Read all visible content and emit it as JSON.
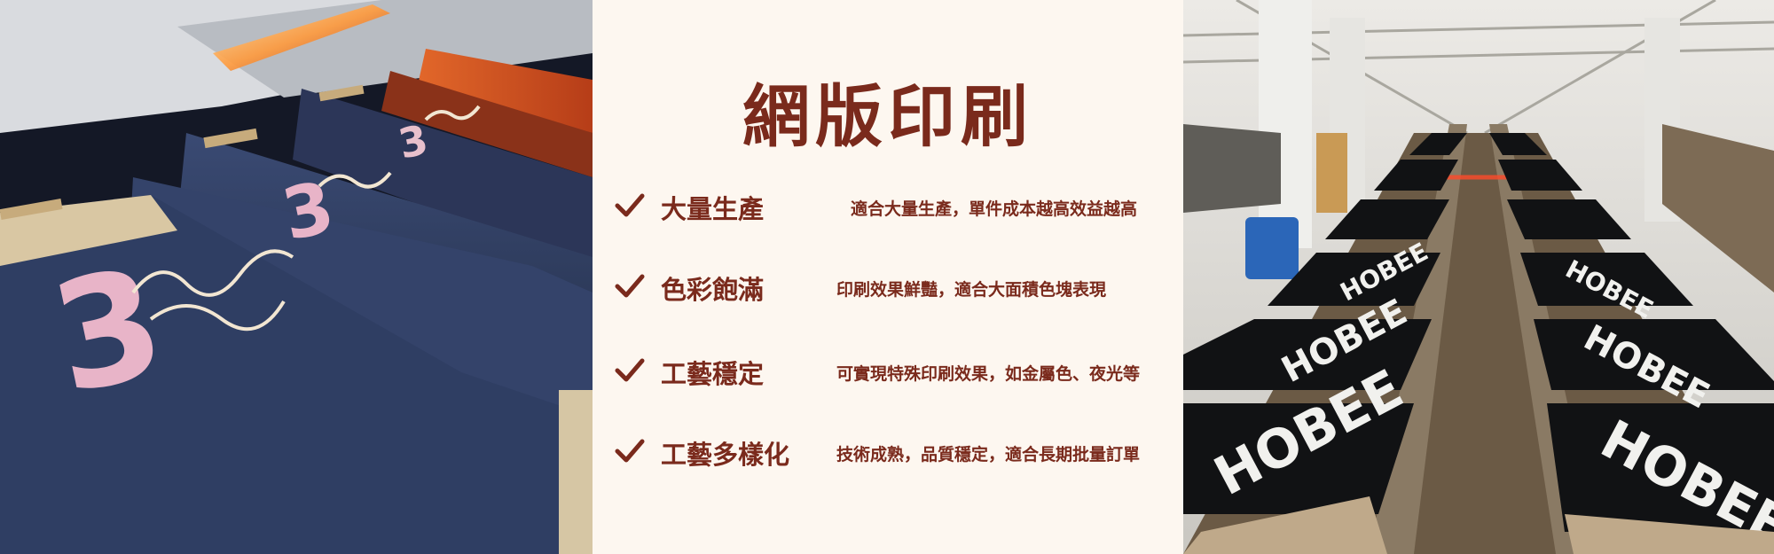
{
  "title": "網版印刷",
  "features": [
    {
      "title": "大量生產",
      "desc": "適合大量生產，單件成本越高效益越高"
    },
    {
      "title": "色彩飽滿",
      "desc": "印刷效果鮮豔，適合大面積色塊表現"
    },
    {
      "title": "工藝穩定",
      "desc": "可實現特殊印刷效果，如金屬色、夜光等"
    },
    {
      "title": "工藝多樣化",
      "desc": "技術成熟，品質穩定，適合長期批量訂單"
    }
  ],
  "colors": {
    "accent": "#7a2a1c",
    "background": "#fdf7f0"
  },
  "icons": {
    "check": "check-icon"
  }
}
